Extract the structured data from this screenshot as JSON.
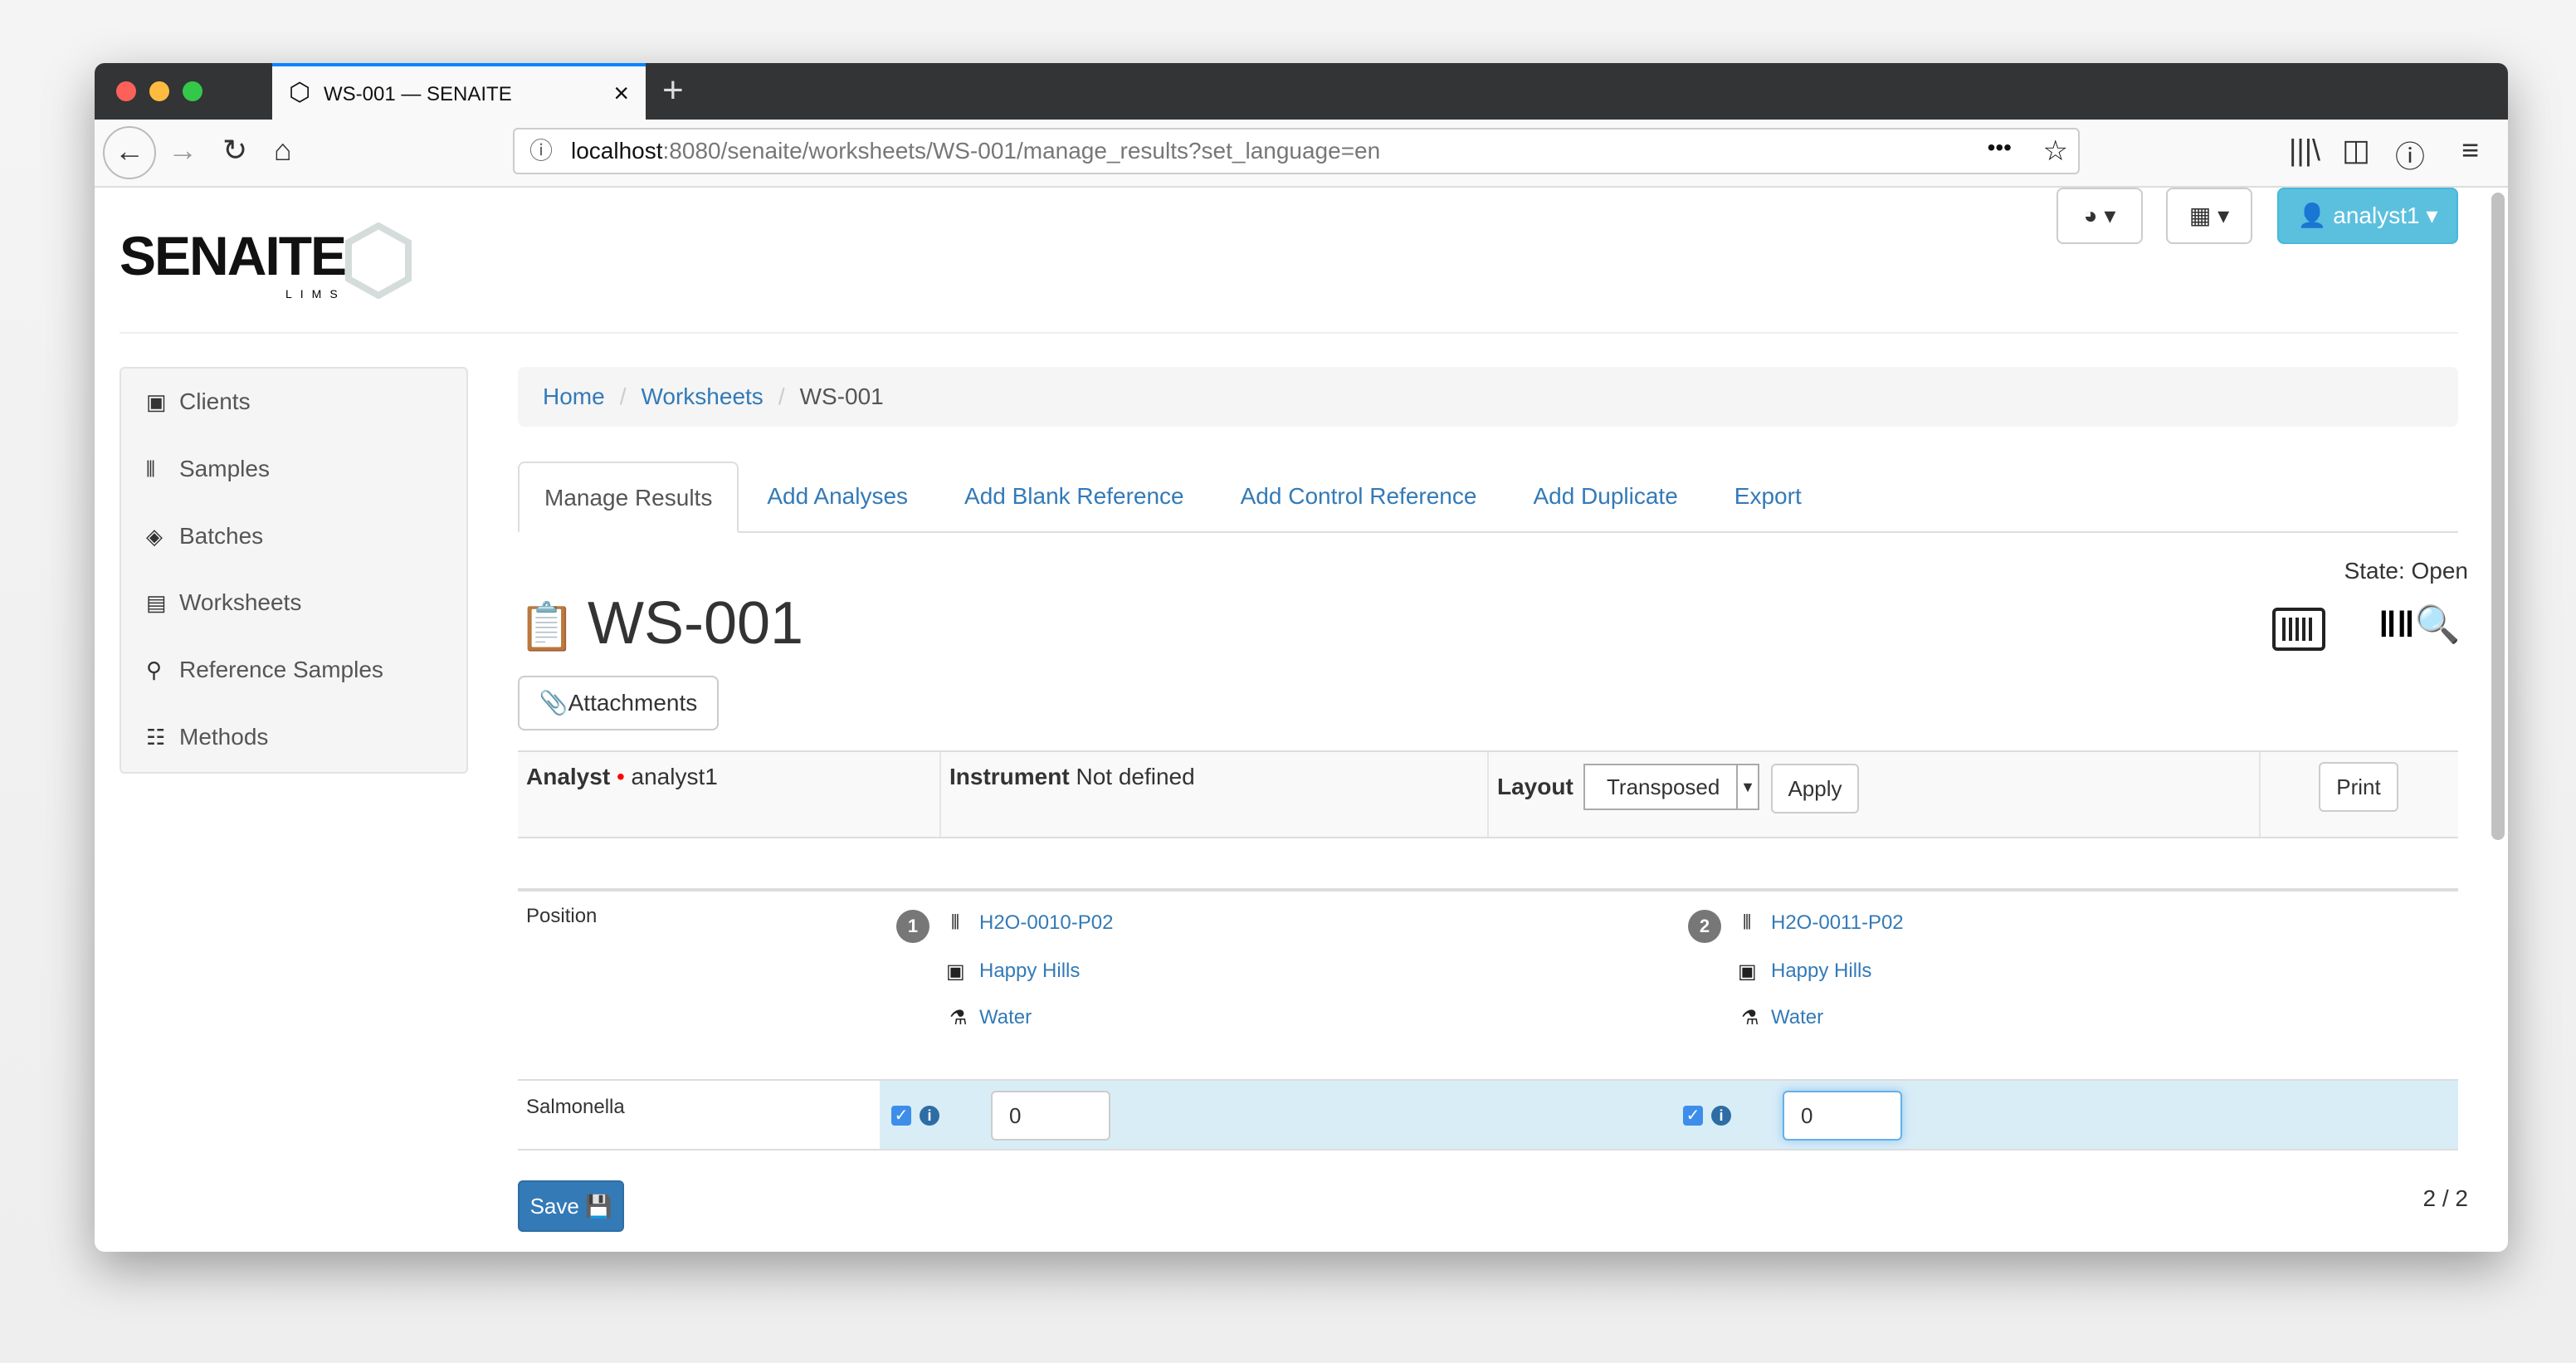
{
  "browser": {
    "tab_title": "WS-001 — SENAITE",
    "url_host": "localhost",
    "url_path": ":8080/senaite/worksheets/WS-001/manage_results?set_language=en"
  },
  "header": {
    "logo": "SENAITE",
    "logo_sub": "LIMS",
    "user": "analyst1"
  },
  "sidebar": {
    "items": [
      {
        "label": "Clients"
      },
      {
        "label": "Samples"
      },
      {
        "label": "Batches"
      },
      {
        "label": "Worksheets"
      },
      {
        "label": "Reference Samples"
      },
      {
        "label": "Methods"
      }
    ]
  },
  "breadcrumb": [
    "Home",
    "Worksheets",
    "WS-001"
  ],
  "tabs": [
    "Manage Results",
    "Add Analyses",
    "Add Blank Reference",
    "Add Control Reference",
    "Add Duplicate",
    "Export"
  ],
  "state": "State: Open",
  "title": "WS-001",
  "attachments": "Attachments",
  "info": {
    "analyst_label": "Analyst",
    "analyst": "analyst1",
    "instrument_label": "Instrument",
    "instrument": "Not defined",
    "layout_label": "Layout",
    "layout": "Transposed",
    "apply": "Apply",
    "print": "Print"
  },
  "grid": {
    "position_label": "Position",
    "positions": [
      {
        "num": "1",
        "sample": "H2O-0010-P02",
        "client": "Happy Hills",
        "type": "Water"
      },
      {
        "num": "2",
        "sample": "H2O-0011-P02",
        "client": "Happy Hills",
        "type": "Water"
      }
    ],
    "analysis": "Salmonella",
    "results": [
      "0",
      "0"
    ]
  },
  "save": "Save",
  "pagination": "2 / 2",
  "colors": {
    "link": "#337ab7",
    "primary": "#337ab7",
    "user_button": "#5bc0de",
    "result_row": "#d9edf7"
  }
}
